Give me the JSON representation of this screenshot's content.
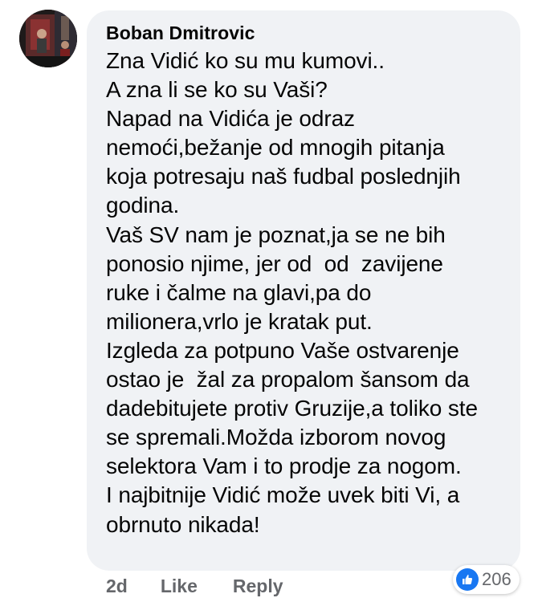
{
  "comment": {
    "author": "Boban Dmitrovic",
    "lines": [
      "Zna Vidić ko su mu kumovi..",
      "A zna li se ko su Vaši?",
      "Napad na Vidića je odraz",
      "nemoći,bežanje od mnogih pitanja",
      "koja potresaju naš fudbal poslednjih",
      "godina.",
      "Vaš SV nam je poznat,ja se ne bih",
      "ponosio njime, jer od  od  zavijene",
      "ruke i čalme na glavi,pa do",
      "milionera,vrlo je kratak put.",
      "Izgleda za potpuno Vaše ostvarenje",
      "ostao je  žal za propalom šansom da",
      "dadebitujete protiv Gruzije,a toliko ste",
      "se spremali.Možda izborom novog",
      "selektora Vam i to prodje za nogom.",
      "I najbitnije Vidić može uvek biti Vi, a",
      "obrnuto nikada!"
    ]
  },
  "actions": {
    "time": "2d",
    "like_label": "Like",
    "reply_label": "Reply"
  },
  "reactions": {
    "icon": "thumbs-up-icon",
    "count": "206",
    "color": "#1877f2"
  },
  "colors": {
    "bubble_bg": "#f0f2f5",
    "text": "#050505",
    "secondary": "#65676b"
  }
}
